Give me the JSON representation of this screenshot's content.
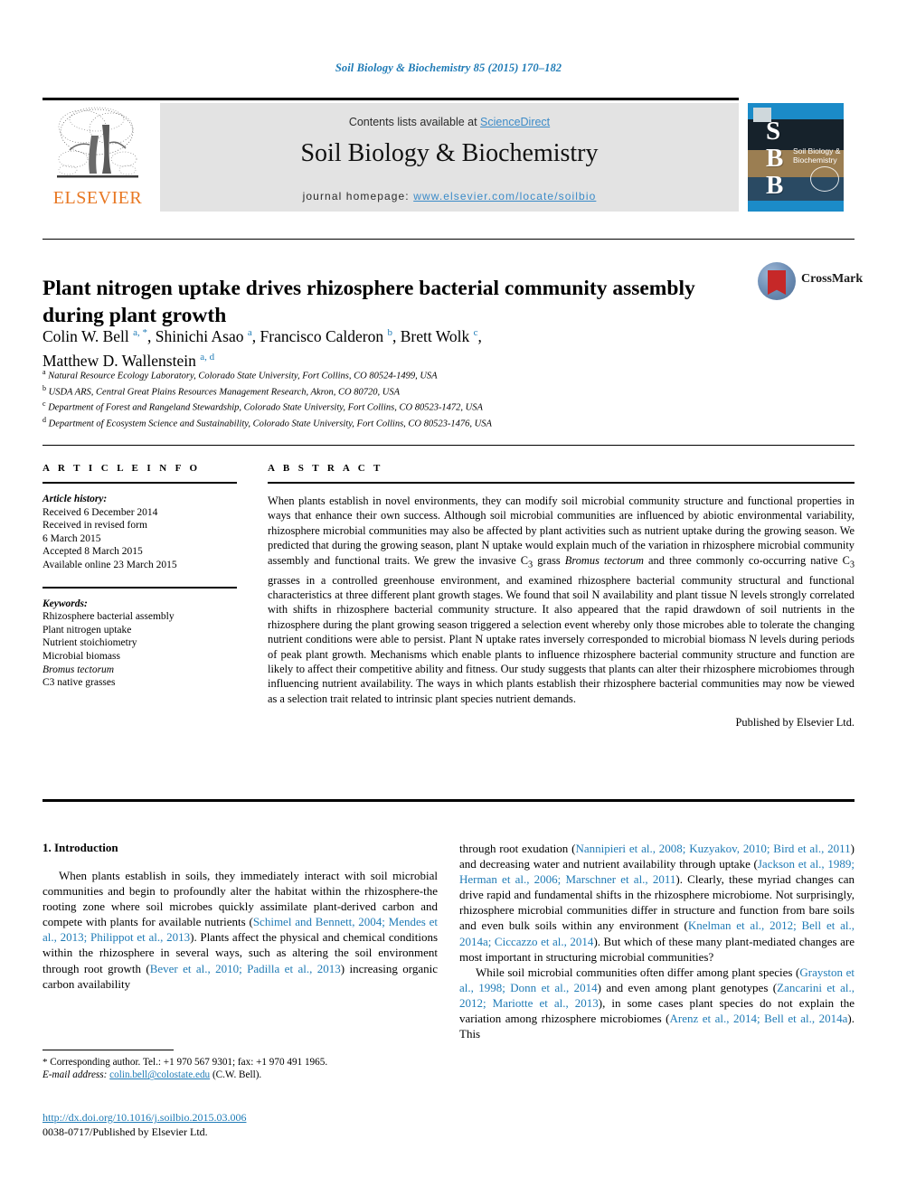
{
  "running_head": "Soil Biology & Biochemistry 85 (2015) 170–182",
  "masthead": {
    "contents_prefix": "Contents lists available at ",
    "sciencedirect": "ScienceDirect",
    "journal_title": "Soil Biology & Biochemistry",
    "homepage_label": "journal homepage: ",
    "homepage_url": "www.elsevier.com/locate/soilbio",
    "publisher_logo_text": "ELSEVIER",
    "cover_letters": "S\nB\nB",
    "cover_title": "Soil Biology & Biochemistry",
    "accent_blue": "#1f7bb6",
    "link_blue": "#3c8bc8",
    "elsevier_orange": "#e87722",
    "band_gray": "#e3e3e3",
    "cover_blue": "#1b8bc8"
  },
  "article": {
    "title": "Plant nitrogen uptake drives rhizosphere bacterial community assembly during plant growth",
    "crossmark_label": "CrossMark",
    "authors_line1": "Colin W. Bell <sup>a, *</sup>, Shinichi Asao <sup>a</sup>, Francisco Calderon <sup>b</sup>, Brett Wolk <sup>c</sup>,",
    "authors_line2": "Matthew D. Wallenstein <sup>a, d</sup>",
    "affiliations": [
      {
        "mark": "a",
        "text": "Natural Resource Ecology Laboratory, Colorado State University, Fort Collins, CO 80524-1499, USA"
      },
      {
        "mark": "b",
        "text": "USDA ARS, Central Great Plains Resources Management Research, Akron, CO 80720, USA"
      },
      {
        "mark": "c",
        "text": "Department of Forest and Rangeland Stewardship, Colorado State University, Fort Collins, CO 80523-1472, USA"
      },
      {
        "mark": "d",
        "text": "Department of Ecosystem Science and Sustainability, Colorado State University, Fort Collins, CO 80523-1476, USA"
      }
    ]
  },
  "article_info": {
    "heading": "A R T I C L E   I N F O",
    "history_label": "Article history:",
    "history": [
      "Received 6 December 2014",
      "Received in revised form",
      "6 March 2015",
      "Accepted 8 March 2015",
      "Available online 23 March 2015"
    ],
    "keywords_label": "Keywords:",
    "keywords": [
      {
        "text": "Rhizosphere bacterial assembly",
        "italic": false
      },
      {
        "text": "Plant nitrogen uptake",
        "italic": false
      },
      {
        "text": "Nutrient stoichiometry",
        "italic": false
      },
      {
        "text": "Microbial biomass",
        "italic": false
      },
      {
        "text": "Bromus tectorum",
        "italic": true
      },
      {
        "text": "C3 native grasses",
        "italic": false
      }
    ]
  },
  "abstract": {
    "heading": "A B S T R A C T",
    "text_html": "When plants establish in novel environments, they can modify soil microbial community structure and functional properties in ways that enhance their own success. Although soil microbial communities are influenced by abiotic environmental variability, rhizosphere microbial communities may also be affected by plant activities such as nutrient uptake during the growing season. We predicted that during the growing season, plant N uptake would explain much of the variation in rhizosphere microbial community assembly and functional traits. We grew the invasive C<sub>3</sub> grass <span class=\"ital\">Bromus tectorum</span> and three commonly co-occurring native C<sub>3</sub> grasses in a controlled greenhouse environment, and examined rhizosphere bacterial community structural and functional characteristics at three different plant growth stages. We found that soil N availability and plant tissue N levels strongly correlated with shifts in rhizosphere bacterial community structure. It also appeared that the rapid drawdown of soil nutrients in the rhizosphere during the plant growing season triggered a selection event whereby only those microbes able to tolerate the changing nutrient conditions were able to persist. Plant N uptake rates inversely corresponded to microbial biomass N levels during periods of peak plant growth. Mechanisms which enable plants to influence rhizosphere bacterial community structure and function are likely to affect their competitive ability and fitness. Our study suggests that plants can alter their rhizosphere microbiomes through influencing nutrient availability. The ways in which plants establish their rhizosphere bacterial communities may now be viewed as a selection trait related to intrinsic plant species nutrient demands.",
    "published_by": "Published by Elsevier Ltd."
  },
  "body": {
    "section_number_title": "1. Introduction",
    "left_paragraph_html": "When plants establish in soils, they immediately interact with soil microbial communities and begin to profoundly alter the habitat within the rhizosphere-the rooting zone where soil microbes quickly assimilate plant-derived carbon and compete with plants for available nutrients (<span class=\"cite\">Schimel and Bennett, 2004; Mendes et al., 2013; Philippot et al., 2013</span>). Plants affect the physical and chemical conditions within the rhizosphere in several ways, such as altering the soil environment through root growth (<span class=\"cite\">Bever et al., 2010; Padilla et al., 2013</span>) increasing organic carbon availability",
    "right_paragraph1_html": "through root exudation (<span class=\"cite\">Nannipieri et al., 2008; Kuzyakov, 2010; Bird et al., 2011</span>) and decreasing water and nutrient availability through uptake (<span class=\"cite\">Jackson et al., 1989; Herman et al., 2006; Marschner et al., 2011</span>). Clearly, these myriad changes can drive rapid and fundamental shifts in the rhizosphere microbiome. Not surprisingly, rhizosphere microbial communities differ in structure and function from bare soils and even bulk soils within any environment (<span class=\"cite\">Knelman et al., 2012; Bell et al., 2014a; Ciccazzo et al., 2014</span>). But which of these many plant-mediated changes are most important in structuring microbial communities?",
    "right_paragraph2_html": "While soil microbial communities often differ among plant species (<span class=\"cite\">Grayston et al., 1998; Donn et al., 2014</span>) and even among plant genotypes (<span class=\"cite\">Zancarini et al., 2012; Mariotte et al., 2013</span>), in some cases plant species do not explain the variation among rhizosphere microbiomes (<span class=\"cite\">Arenz et al., 2014; Bell et al., 2014a</span>). This"
  },
  "footer": {
    "corresponding_html": "<span class=\"star\">*</span> Corresponding author. Tel.: +1 970 567 9301; fax: +1 970 491 1965.",
    "email_label": "E-mail address:",
    "email": "colin.bell@colostate.edu",
    "email_suffix": "(C.W. Bell).",
    "doi_url": "http://dx.doi.org/10.1016/j.soilbio.2015.03.006",
    "issn_line": "0038-0717/Published by Elsevier Ltd."
  }
}
